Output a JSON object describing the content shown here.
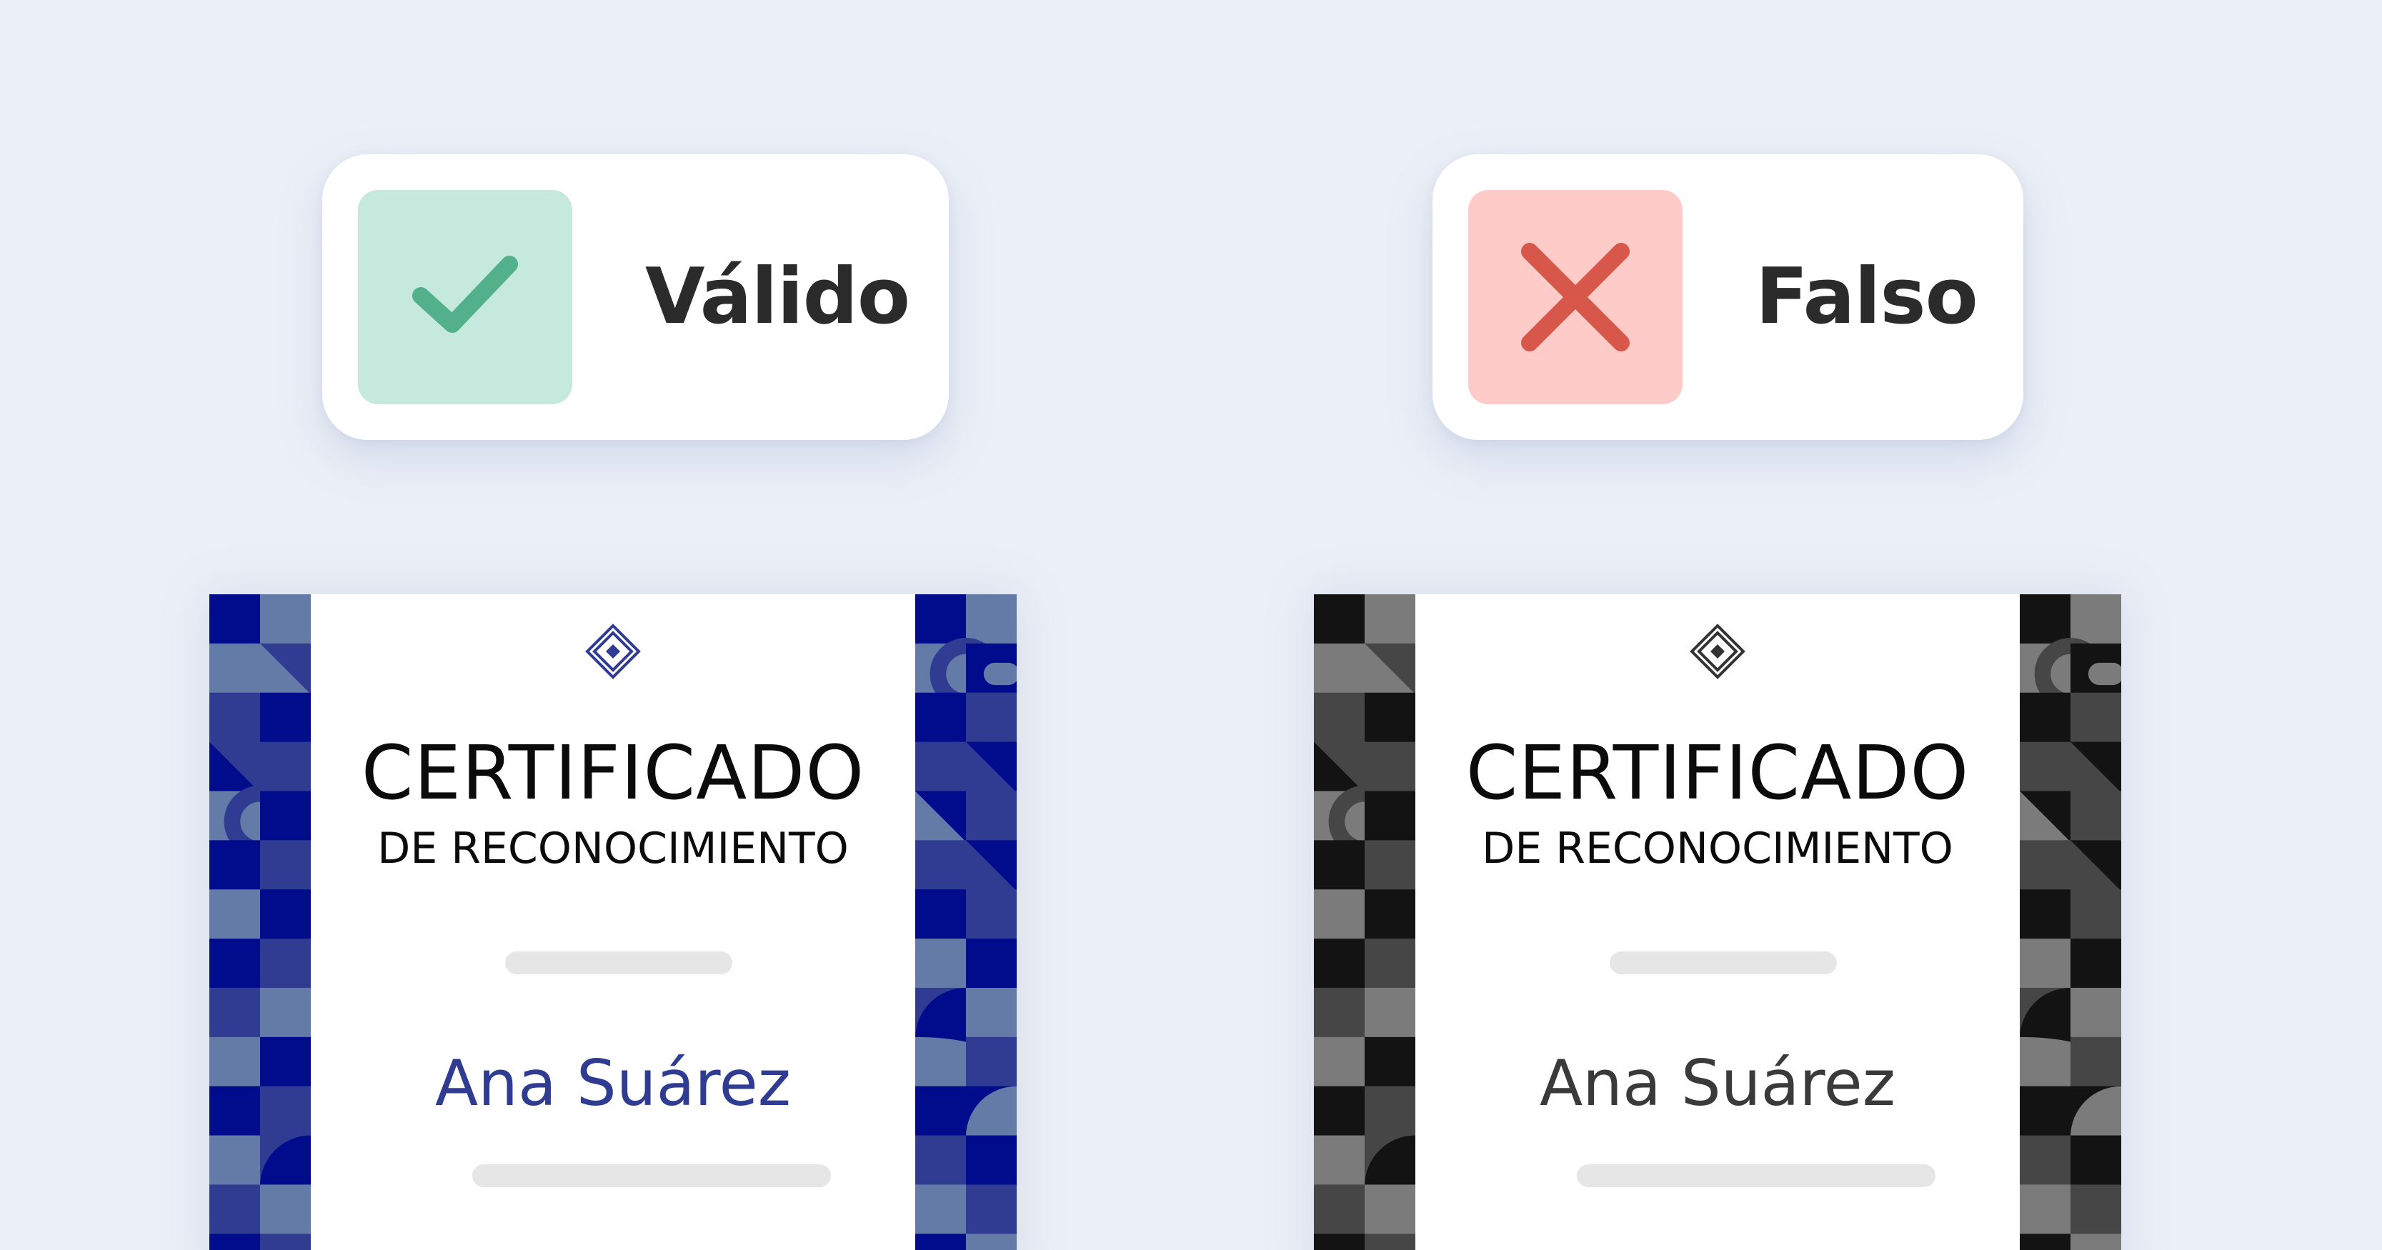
{
  "status_cards": {
    "valid": {
      "label": "Válido",
      "icon": "checkmark-icon",
      "icon_color": "#52b08c",
      "background": "#c6e9dd"
    },
    "fake": {
      "label": "Falso",
      "icon": "cross-icon",
      "icon_color": "#d7584b",
      "background": "#fecbc8"
    }
  },
  "certificates": {
    "genuine": {
      "title": "CERTIFICADO",
      "subtitle": "DE RECONOCIMIENTO",
      "recipient_name": "Ana Suárez",
      "emblem": "diamond-emblem-icon",
      "palette": [
        "#000c8c",
        "#2f3c92",
        "#647ba7"
      ],
      "name_color": "#2f3c92"
    },
    "forged": {
      "title": "CERTIFICADO",
      "subtitle": "DE RECONOCIMIENTO",
      "recipient_name": "Ana Suárez",
      "emblem": "diamond-emblem-icon",
      "palette": [
        "#131313",
        "#464646",
        "#7b7b7b"
      ],
      "name_color": "#3a3a3a"
    }
  }
}
